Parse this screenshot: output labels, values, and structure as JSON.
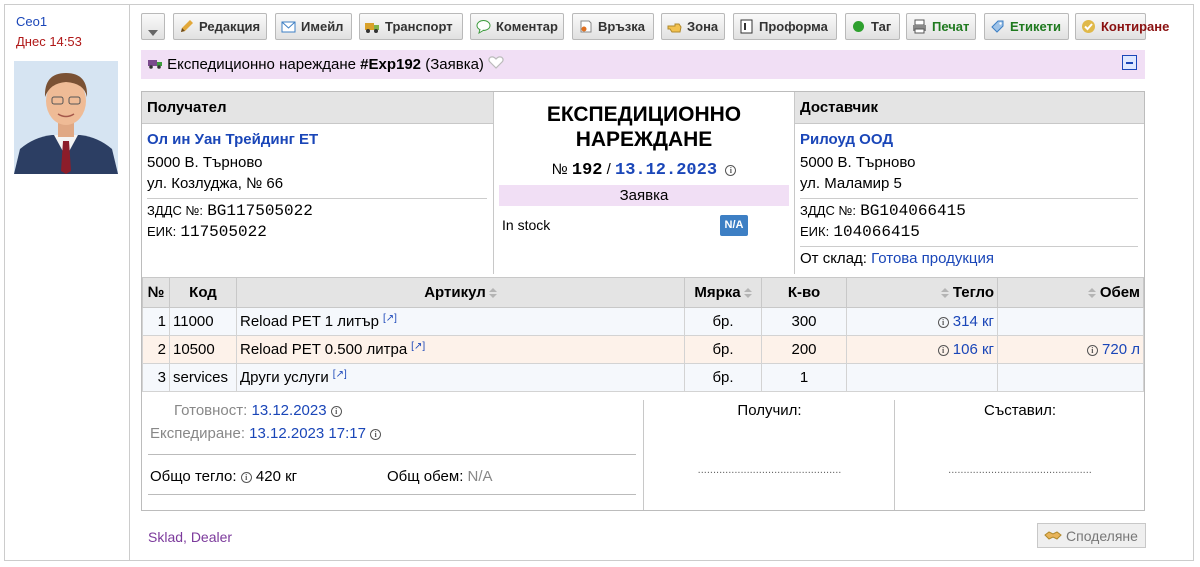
{
  "user": {
    "name": "Ceo1",
    "time": "Днес 14:53"
  },
  "toolbar": {
    "buttons": [
      {
        "label": "Редакция"
      },
      {
        "label": "Имейл"
      },
      {
        "label": "Транспорт"
      },
      {
        "label": "Коментар"
      },
      {
        "label": "Връзка"
      },
      {
        "label": "Зона"
      },
      {
        "label": "Проформа"
      },
      {
        "label": "Таг"
      },
      {
        "label": "Печат"
      },
      {
        "label": "Етикети"
      },
      {
        "label": "Контиране"
      }
    ]
  },
  "title": {
    "prefix": "Експедиционно нареждане",
    "code": "#Exp192",
    "status": "(Заявка)"
  },
  "recipient": {
    "heading": "Получател",
    "name": "Ол ин Уан Трейдинг ЕТ",
    "city": "5000 В. Търново",
    "street": "ул. Козлуджа, № 66",
    "vat_label": "ЗДДС №:",
    "vat": "BG117505022",
    "eik_label": "ЕИК:",
    "eik": "117505022"
  },
  "document": {
    "title_line1": "ЕКСПЕДИЦИОННО",
    "title_line2": "НАРЕЖДАНЕ",
    "num_prefix": "№",
    "number": "192",
    "sep": "/",
    "date": "13.12.2023",
    "stage": "Заявка",
    "stock": "In stock",
    "stock_badge": "N/A"
  },
  "supplier": {
    "heading": "Доставчик",
    "name": "Рилоуд ООД",
    "city": "5000 В. Търново",
    "street": "ул. Маламир 5",
    "vat_label": "ЗДДС №:",
    "vat": "BG104066415",
    "eik_label": "ЕИК:",
    "eik": "104066415",
    "store_label": "От склад:",
    "store": "Готова продукция"
  },
  "table": {
    "headers": {
      "num": "№",
      "code": "Код",
      "article": "Артикул",
      "unit": "Мярка",
      "qty": "К-во",
      "weight": "Тегло",
      "volume": "Обем"
    },
    "rows": [
      {
        "num": "1",
        "code": "11000",
        "article": "Reload PET 1 литър",
        "unit": "бр.",
        "qty": "300",
        "weight": "314 кг",
        "volume": ""
      },
      {
        "num": "2",
        "code": "10500",
        "article": "Reload PET 0.500 литра",
        "unit": "бр.",
        "qty": "200",
        "weight": "106 кг",
        "volume": "720 л"
      },
      {
        "num": "3",
        "code": "services",
        "article": "Други услуги",
        "unit": "бр.",
        "qty": "1",
        "weight": "",
        "volume": ""
      }
    ]
  },
  "footer": {
    "ready_label": "Готовност:",
    "ready": "13.12.2023",
    "ship_label": "Експедиране:",
    "ship": "13.12.2023 17:17",
    "weight_label": "Общо тегло:",
    "weight": "420 кг",
    "volume_label": "Общ обем:",
    "volume": "N/A",
    "received_label": "Получил:",
    "composed_label": "Съставил:",
    "dots": "..............................................."
  },
  "tags": {
    "first": "Sklad",
    "sep": ",",
    "second": "Dealer"
  },
  "share": {
    "label": "Споделяне"
  },
  "colors": {
    "accent": "#1a46b8",
    "header_bg": "#e4e4e4",
    "title_bg": "#f1dff5",
    "row_alt": "#fdf2ea",
    "row_base": "#f5f8fc"
  }
}
